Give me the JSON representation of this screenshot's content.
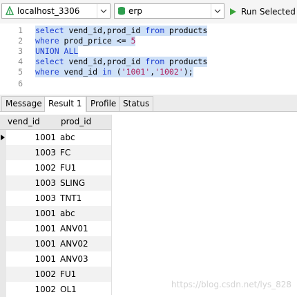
{
  "toolbar": {
    "connection": "localhost_3306",
    "database": "erp",
    "run_label": "Run Selected",
    "colors": {
      "run_icon": "#3aa33a",
      "db_icon": "#2e9e4f",
      "conn_icon": "#2e9e4f"
    }
  },
  "editor": {
    "lines": [
      {
        "num": "1",
        "tokens": [
          {
            "t": "kw",
            "v": "select"
          },
          {
            "t": "plain",
            "v": " vend_id,prod_id "
          },
          {
            "t": "kw",
            "v": "from"
          },
          {
            "t": "plain",
            "v": " products"
          }
        ]
      },
      {
        "num": "2",
        "tokens": [
          {
            "t": "kw",
            "v": "where"
          },
          {
            "t": "plain",
            "v": " prod_price <= "
          },
          {
            "t": "num",
            "v": "5"
          }
        ]
      },
      {
        "num": "3",
        "tokens": [
          {
            "t": "kw",
            "v": "UNION ALL"
          }
        ]
      },
      {
        "num": "4",
        "tokens": [
          {
            "t": "kw",
            "v": "select"
          },
          {
            "t": "plain",
            "v": " vend_id,prod_id "
          },
          {
            "t": "kw",
            "v": "from"
          },
          {
            "t": "plain",
            "v": " products"
          }
        ]
      },
      {
        "num": "5",
        "tokens": [
          {
            "t": "kw",
            "v": "where"
          },
          {
            "t": "plain",
            "v": " vend_id "
          },
          {
            "t": "kw",
            "v": "in"
          },
          {
            "t": "plain",
            "v": " ("
          },
          {
            "t": "str",
            "v": "'1001'"
          },
          {
            "t": "plain",
            "v": ","
          },
          {
            "t": "str",
            "v": "'1002'"
          },
          {
            "t": "plain",
            "v": ");"
          }
        ]
      },
      {
        "num": "6",
        "tokens": []
      }
    ]
  },
  "tabs": [
    "Message",
    "Result 1",
    "Profile",
    "Status"
  ],
  "active_tab": "Result 1",
  "grid": {
    "columns": [
      "vend_id",
      "prod_id"
    ],
    "rows": [
      [
        "1001",
        "abc"
      ],
      [
        "1003",
        "FC"
      ],
      [
        "1002",
        "FU1"
      ],
      [
        "1003",
        "SLING"
      ],
      [
        "1003",
        "TNT1"
      ],
      [
        "1001",
        "abc"
      ],
      [
        "1001",
        "ANV01"
      ],
      [
        "1001",
        "ANV02"
      ],
      [
        "1001",
        "ANV03"
      ],
      [
        "1002",
        "FU1"
      ],
      [
        "1002",
        "OL1"
      ]
    ]
  },
  "watermark": "https://blog.csdn.net/lys_828"
}
